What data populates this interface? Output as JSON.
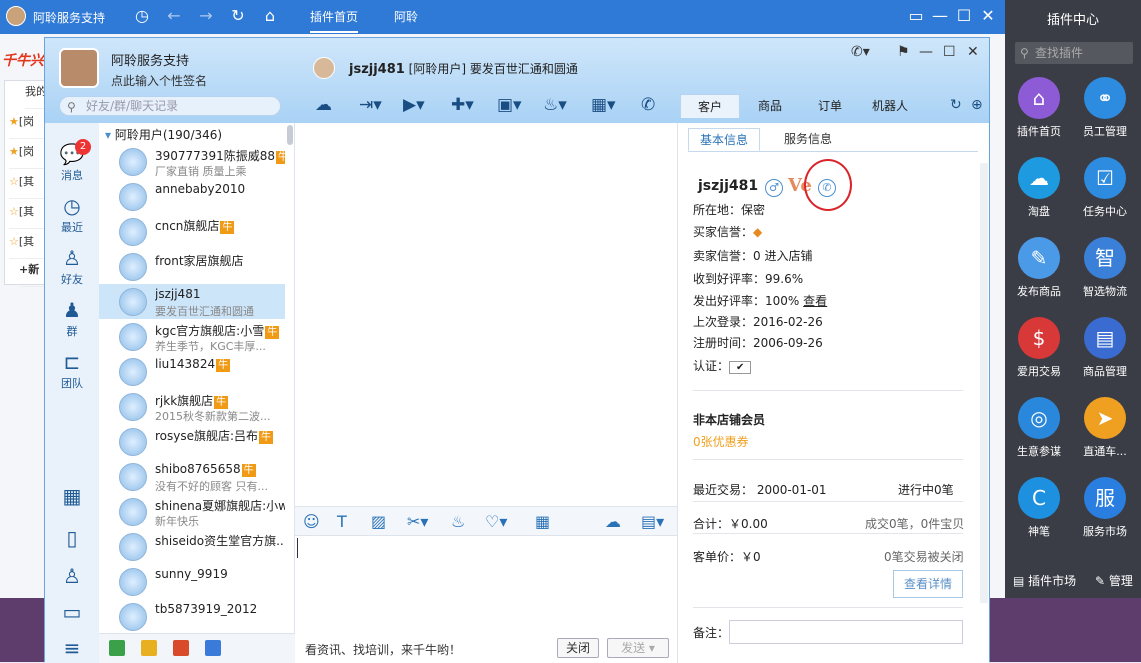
{
  "bg": {
    "title": "阿聆服务支持",
    "tabs": [
      "插件首页",
      "阿聆"
    ],
    "logo": "千牛兴",
    "rows": [
      "[岗",
      "[岗",
      "[其",
      "[其",
      "[其"
    ],
    "tab_label": "我的",
    "add_label": "+新"
  },
  "header": {
    "my_name": "阿聆服务支持",
    "my_signature": "点此输入个性签名",
    "search_placeholder": "好友/群/聊天记录",
    "peer_name": "jszjj481",
    "peer_tag": "[阿聆用户]",
    "peer_status": "要发百世汇通和圆通",
    "right_tabs": [
      "客户",
      "商品",
      "订单",
      "机器人"
    ]
  },
  "left_nav": {
    "items": [
      {
        "label": "消息",
        "icon": "message-icon",
        "badge": "2"
      },
      {
        "label": "最近",
        "icon": "clock-icon"
      },
      {
        "label": "好友",
        "icon": "friend-icon"
      },
      {
        "label": "群",
        "icon": "group-icon"
      },
      {
        "label": "团队",
        "icon": "team-icon"
      }
    ]
  },
  "contacts": {
    "group_header": "阿聆用户(190/346)",
    "items": [
      {
        "name": "390777391陈振威88",
        "niu": true,
        "sub": "厂家直销 质量上乘"
      },
      {
        "name": "annebaby2010",
        "niu": false,
        "sub": ""
      },
      {
        "name": "cncn旗舰店",
        "niu": true,
        "sub": ""
      },
      {
        "name": "front家居旗舰店",
        "niu": false,
        "sub": ""
      },
      {
        "name": "jszjj481",
        "niu": false,
        "sub": "要发百世汇通和圆通"
      },
      {
        "name": "kgc官方旗舰店:小雪",
        "niu": true,
        "sub": "养生季节，KGC丰厚..."
      },
      {
        "name": "liu143824",
        "niu": true,
        "sub": ""
      },
      {
        "name": "rjkk旗舰店",
        "niu": true,
        "sub": "2015秋冬新款第二波..."
      },
      {
        "name": "rosyse旗舰店:吕布",
        "niu": true,
        "sub": ""
      },
      {
        "name": "shibo8765658",
        "niu": true,
        "sub": "没有不好的顾客 只有..."
      },
      {
        "name": "shinena夏娜旗舰店:小w",
        "niu": false,
        "sub": "新年快乐"
      },
      {
        "name": "shiseido资生堂官方旗...",
        "niu": false,
        "sub": ""
      },
      {
        "name": "sunny_9919",
        "niu": false,
        "sub": ""
      },
      {
        "name": "tb5873919_2012",
        "niu": false,
        "sub": ""
      }
    ]
  },
  "chat": {
    "ad_text": "看资讯、找培训，来千牛哟！",
    "close_label": "关闭",
    "send_label": "发送"
  },
  "info": {
    "tabs": [
      "基本信息",
      "服务信息"
    ],
    "name": "jszjj481",
    "location": "所在地：保密",
    "buyer_credit": "买家信誉：",
    "seller_credit": "卖家信誉：0",
    "enter_shop": "进入店铺",
    "good_rate_received": "收到好评率：99.6%",
    "good_rate_given": "发出好评率：100%",
    "view_label": "查看",
    "last_login": "上次登录：2016-02-26",
    "register_time": "注册时间：2006-09-26",
    "certification": "认证：",
    "member_status": "非本店铺会员",
    "coupons": "0张优惠券",
    "recent_trade": "最近交易：  2000-01-01",
    "in_progress": "进行中0笔",
    "total": "合计：￥0.00",
    "deals": "成交0笔，0件宝贝",
    "unit_price": "客单价：￥0",
    "closed": "0笔交易被关闭",
    "details_btn": "查看详情",
    "note_label": "备注："
  },
  "plugins": {
    "title": "插件中心",
    "search_placeholder": "查找插件",
    "items": [
      {
        "label": "插件首页",
        "color": "#8e5bd6",
        "glyph": "⌂"
      },
      {
        "label": "员工管理",
        "color": "#2d8be0",
        "glyph": "⚭"
      },
      {
        "label": "淘盘",
        "color": "#1e9be0",
        "glyph": "☁"
      },
      {
        "label": "任务中心",
        "color": "#2d8be0",
        "glyph": "☑"
      },
      {
        "label": "发布商品",
        "color": "#4a9ae8",
        "glyph": "✎"
      },
      {
        "label": "智选物流",
        "color": "#3a7fd8",
        "glyph": "智"
      },
      {
        "label": "爱用交易",
        "color": "#d83838",
        "glyph": "$"
      },
      {
        "label": "商品管理",
        "color": "#3a6bd0",
        "glyph": "▤"
      },
      {
        "label": "生意参谋",
        "color": "#2a88dc",
        "glyph": "◎"
      },
      {
        "label": "直通车...",
        "color": "#f0a020",
        "glyph": "➤"
      },
      {
        "label": "神笔",
        "color": "#1e90e0",
        "glyph": "C"
      },
      {
        "label": "服务市场",
        "color": "#2a7ee0",
        "glyph": "服"
      }
    ],
    "market_label": "插件市场",
    "manage_label": "管理"
  }
}
